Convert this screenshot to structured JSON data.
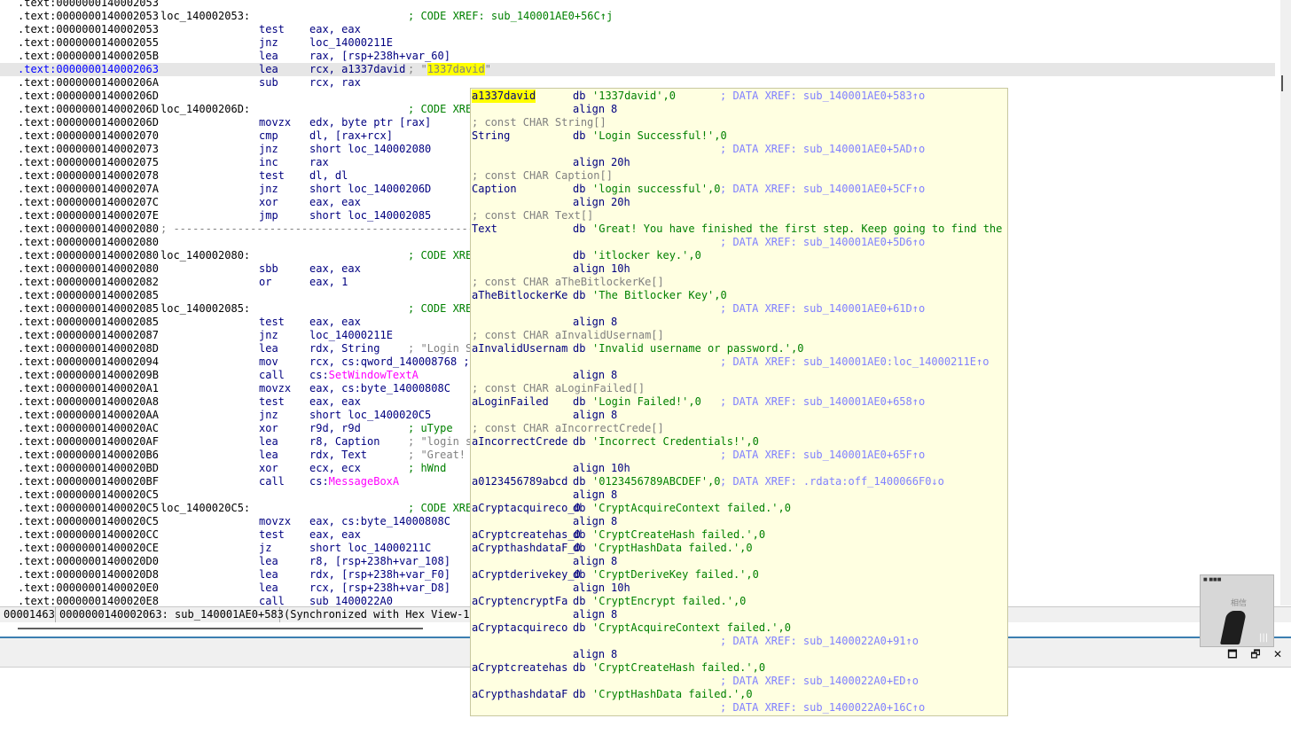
{
  "listing": {
    "lines": [
      {
        "addr": ".text:0000000140002053",
        "label": "",
        "mnem": "",
        "ops": "",
        "cmt": ""
      },
      {
        "addr": ".text:0000000140002053",
        "label": "loc_140002053:",
        "mnem": "",
        "ops": "",
        "cmt": "; CODE XREF: sub_140001AE0+56C↑j"
      },
      {
        "addr": ".text:0000000140002053",
        "label": "",
        "mnem": "test",
        "ops": "eax, eax",
        "cmt": ""
      },
      {
        "addr": ".text:0000000140002055",
        "label": "",
        "mnem": "jnz",
        "ops": "loc_14000211E",
        "cmt": ""
      },
      {
        "addr": ".text:000000014000205B",
        "label": "",
        "mnem": "lea",
        "ops": "rax, [rsp+238h+var_60]",
        "cmt": ""
      },
      {
        "addr": ".text:0000000140002063",
        "label": "",
        "mnem": "lea",
        "ops": "rcx, a1337david",
        "cmt": "; \"1337david\"",
        "current": true
      },
      {
        "addr": ".text:000000014000206A",
        "label": "",
        "mnem": "sub",
        "ops": "rcx, rax",
        "cmt": ""
      },
      {
        "addr": ".text:000000014000206D",
        "label": "",
        "mnem": "",
        "ops": "",
        "cmt": ""
      },
      {
        "addr": ".text:000000014000206D",
        "label": "loc_14000206D:",
        "mnem": "",
        "ops": "",
        "cmt": "; CODE XRE"
      },
      {
        "addr": ".text:000000014000206D",
        "label": "",
        "mnem": "movzx",
        "ops": "edx, byte ptr [rax]",
        "cmt": ""
      },
      {
        "addr": ".text:0000000140002070",
        "label": "",
        "mnem": "cmp",
        "ops": "dl, [rax+rcx]",
        "cmt": ""
      },
      {
        "addr": ".text:0000000140002073",
        "label": "",
        "mnem": "jnz",
        "ops": "short loc_140002080",
        "cmt": ""
      },
      {
        "addr": ".text:0000000140002075",
        "label": "",
        "mnem": "inc",
        "ops": "rax",
        "cmt": ""
      },
      {
        "addr": ".text:0000000140002078",
        "label": "",
        "mnem": "test",
        "ops": "dl, dl",
        "cmt": ""
      },
      {
        "addr": ".text:000000014000207A",
        "label": "",
        "mnem": "jnz",
        "ops": "short loc_14000206D",
        "cmt": ""
      },
      {
        "addr": ".text:000000014000207C",
        "label": "",
        "mnem": "xor",
        "ops": "eax, eax",
        "cmt": ""
      },
      {
        "addr": ".text:000000014000207E",
        "label": "",
        "mnem": "jmp",
        "ops": "short loc_140002085",
        "cmt": ""
      },
      {
        "addr": ".text:0000000140002080",
        "label": "; -----------------------------------------------------",
        "mnem": "",
        "ops": "",
        "cmt": "",
        "separator": true
      },
      {
        "addr": ".text:0000000140002080",
        "label": "",
        "mnem": "",
        "ops": "",
        "cmt": ""
      },
      {
        "addr": ".text:0000000140002080",
        "label": "loc_140002080:",
        "mnem": "",
        "ops": "",
        "cmt": "; CODE XRE"
      },
      {
        "addr": ".text:0000000140002080",
        "label": "",
        "mnem": "sbb",
        "ops": "eax, eax",
        "cmt": ""
      },
      {
        "addr": ".text:0000000140002082",
        "label": "",
        "mnem": "or",
        "ops": "eax, 1",
        "cmt": ""
      },
      {
        "addr": ".text:0000000140002085",
        "label": "",
        "mnem": "",
        "ops": "",
        "cmt": ""
      },
      {
        "addr": ".text:0000000140002085",
        "label": "loc_140002085:",
        "mnem": "",
        "ops": "",
        "cmt": "; CODE XRE"
      },
      {
        "addr": ".text:0000000140002085",
        "label": "",
        "mnem": "test",
        "ops": "eax, eax",
        "cmt": ""
      },
      {
        "addr": ".text:0000000140002087",
        "label": "",
        "mnem": "jnz",
        "ops": "loc_14000211E",
        "cmt": ""
      },
      {
        "addr": ".text:000000014000208D",
        "label": "",
        "mnem": "lea",
        "ops": "rdx, String",
        "cmt": "; \"Login S",
        "cmtgrey": true
      },
      {
        "addr": ".text:0000000140002094",
        "label": "",
        "mnem": "mov",
        "ops": "rcx, cs:qword_140008768 ;",
        "cmt": ""
      },
      {
        "addr": ".text:000000014000209B",
        "label": "",
        "mnem": "call",
        "ops": "cs:",
        "import": "SetWindowTextA",
        "cmt": ""
      },
      {
        "addr": ".text:00000001400020A1",
        "label": "",
        "mnem": "movzx",
        "ops": "eax, cs:byte_14000808C",
        "cmt": ""
      },
      {
        "addr": ".text:00000001400020A8",
        "label": "",
        "mnem": "test",
        "ops": "eax, eax",
        "cmt": ""
      },
      {
        "addr": ".text:00000001400020AA",
        "label": "",
        "mnem": "jnz",
        "ops": "short loc_1400020C5",
        "cmt": ""
      },
      {
        "addr": ".text:00000001400020AC",
        "label": "",
        "mnem": "xor",
        "ops": "r9d, r9d",
        "cmt": "; uType"
      },
      {
        "addr": ".text:00000001400020AF",
        "label": "",
        "mnem": "lea",
        "ops": "r8, Caption",
        "cmt": "; \"login s",
        "cmtgrey": true
      },
      {
        "addr": ".text:00000001400020B6",
        "label": "",
        "mnem": "lea",
        "ops": "rdx, Text",
        "cmt": "; \"Great!",
        "cmtgrey": true
      },
      {
        "addr": ".text:00000001400020BD",
        "label": "",
        "mnem": "xor",
        "ops": "ecx, ecx",
        "cmt": "; hWnd"
      },
      {
        "addr": ".text:00000001400020BF",
        "label": "",
        "mnem": "call",
        "ops": "cs:",
        "import": "MessageBoxA",
        "cmt": ""
      },
      {
        "addr": ".text:00000001400020C5",
        "label": "",
        "mnem": "",
        "ops": "",
        "cmt": ""
      },
      {
        "addr": ".text:00000001400020C5",
        "label": "loc_1400020C5:",
        "mnem": "",
        "ops": "",
        "cmt": "; CODE XRE"
      },
      {
        "addr": ".text:00000001400020C5",
        "label": "",
        "mnem": "movzx",
        "ops": "eax, cs:byte_14000808C",
        "cmt": ""
      },
      {
        "addr": ".text:00000001400020CC",
        "label": "",
        "mnem": "test",
        "ops": "eax, eax",
        "cmt": ""
      },
      {
        "addr": ".text:00000001400020CE",
        "label": "",
        "mnem": "jz",
        "ops": "short loc_14000211C",
        "cmt": ""
      },
      {
        "addr": ".text:00000001400020D0",
        "label": "",
        "mnem": "lea",
        "ops": "r8, [rsp+238h+var_108]",
        "cmt": ""
      },
      {
        "addr": ".text:00000001400020D8",
        "label": "",
        "mnem": "lea",
        "ops": "rdx, [rsp+238h+var_F0]",
        "cmt": ""
      },
      {
        "addr": ".text:00000001400020E0",
        "label": "",
        "mnem": "lea",
        "ops": "rcx, [rsp+238h+var_D8]",
        "cmt": ""
      },
      {
        "addr": ".text:00000001400020E8",
        "label": "",
        "mnem": "call",
        "ops": "sub_1400022A0",
        "cmt": ""
      }
    ]
  },
  "status": {
    "offset": "00001463",
    "location": "0000000140002063: sub_140001AE0+583",
    "sync": "(Synchronized with Hex View-1)"
  },
  "hint": {
    "lines": [
      {
        "name": "a1337david",
        "kw": "db",
        "val": "'1337david',0",
        "xref": "; DATA XREF: sub_140001AE0+583↑o",
        "nameHighlight": true
      },
      {
        "kw": "align",
        "val": "8"
      },
      {
        "cmt": "; const CHAR String[]"
      },
      {
        "name": "String",
        "kw": "db",
        "val": "'Login Successful!',0"
      },
      {
        "xref": "; DATA XREF: sub_140001AE0+5AD↑o"
      },
      {
        "kw": "align",
        "val": "20h"
      },
      {
        "cmt": "; const CHAR Caption[]"
      },
      {
        "name": "Caption",
        "kw": "db",
        "val": "'login successful',0",
        "xref": "; DATA XREF: sub_140001AE0+5CF↑o",
        "xrefInline": true
      },
      {
        "kw": "align",
        "val": "20h"
      },
      {
        "cmt": "; const CHAR Text[]"
      },
      {
        "name": "Text",
        "kw": "db",
        "val": "'Great! You have finished the first step. Keep going to find the b'"
      },
      {
        "xref": "; DATA XREF: sub_140001AE0+5D6↑o"
      },
      {
        "kw": "db",
        "val": "'itlocker key.',0"
      },
      {
        "kw": "align",
        "val": "10h"
      },
      {
        "cmt": "; const CHAR aTheBitlockerKe[]"
      },
      {
        "name": "aTheBitlockerKe",
        "kw": "db",
        "val": "'The Bitlocker Key',0"
      },
      {
        "xref": "; DATA XREF: sub_140001AE0+61D↑o"
      },
      {
        "kw": "align",
        "val": "8"
      },
      {
        "cmt": "; const CHAR aInvalidUsernam[]"
      },
      {
        "name": "aInvalidUsernam",
        "kw": "db",
        "val": "'Invalid username or password.',0"
      },
      {
        "xref": "; DATA XREF: sub_140001AE0:loc_14000211E↑o"
      },
      {
        "kw": "align",
        "val": "8"
      },
      {
        "cmt": "; const CHAR aLoginFailed[]"
      },
      {
        "name": "aLoginFailed",
        "kw": "db",
        "val": "'Login Failed!',0",
        "xref": "; DATA XREF: sub_140001AE0+658↑o"
      },
      {
        "kw": "align",
        "val": "8"
      },
      {
        "cmt": "; const CHAR aIncorrectCrede[]"
      },
      {
        "name": "aIncorrectCrede",
        "kw": "db",
        "val": "'Incorrect Credentials!',0"
      },
      {
        "xref": "; DATA XREF: sub_140001AE0+65F↑o"
      },
      {
        "kw": "align",
        "val": "10h"
      },
      {
        "name": "a0123456789abcd",
        "kw": "db",
        "val": "'0123456789ABCDEF',0",
        "xref": "; DATA XREF: .rdata:off_1400066F0↓o",
        "xrefInline": true
      },
      {
        "kw": "align",
        "val": "8"
      },
      {
        "name": "aCryptacquireco_0",
        "kw": "db",
        "val": "'CryptAcquireContext failed.',0"
      },
      {
        "kw": "align",
        "val": "8"
      },
      {
        "name": "aCryptcreatehas_0",
        "kw": "db",
        "val": "'CryptCreateHash failed.',0"
      },
      {
        "name": "aCrypthashdataF_0",
        "kw": "db",
        "val": "'CryptHashData failed.',0"
      },
      {
        "kw": "align",
        "val": "8"
      },
      {
        "name": "aCryptderivekey_0",
        "kw": "db",
        "val": "'CryptDeriveKey failed.',0"
      },
      {
        "kw": "align",
        "val": "10h"
      },
      {
        "name": "aCryptencryptFa",
        "kw": "db",
        "val": "'CryptEncrypt failed.',0"
      },
      {
        "kw": "align",
        "val": "8"
      },
      {
        "name": "aCryptacquireco",
        "kw": "db",
        "val": "'CryptAcquireContext failed.',0"
      },
      {
        "xref": "; DATA XREF: sub_1400022A0+91↑o"
      },
      {
        "kw": "align",
        "val": "8"
      },
      {
        "name": "aCryptcreatehas",
        "kw": "db",
        "val": "'CryptCreateHash failed.',0"
      },
      {
        "xref": "; DATA XREF: sub_1400022A0+ED↑o"
      },
      {
        "name": "aCrypthashdataF",
        "kw": "db",
        "val": "'CryptHashData failed.',0"
      },
      {
        "xref": "; DATA XREF: sub_1400022A0+16C↑o"
      }
    ]
  },
  "thumbnail": {
    "title": "■ ■■■",
    "text": "相信",
    "bars": "|||"
  },
  "window_buttons": {
    "maximize": "🗖",
    "restore": "🗗",
    "close": "✕"
  },
  "colors": {
    "address": "#000000",
    "current_address": "#0000ff",
    "instruction": "#000080",
    "comment": "#008000",
    "xref": "#8080ff",
    "import": "#ff00ff",
    "hint_background": "#ffffe1",
    "highlight": "#ffff00"
  }
}
